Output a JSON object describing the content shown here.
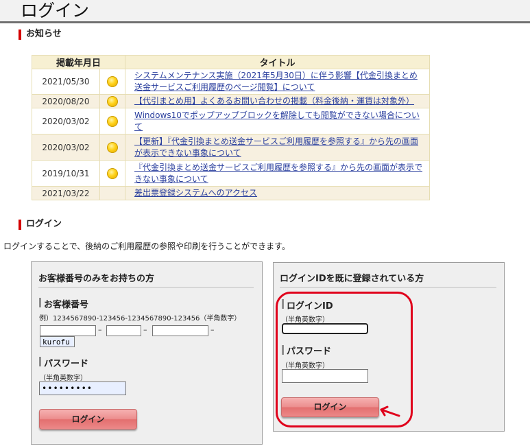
{
  "page": {
    "title": "ログイン"
  },
  "news": {
    "heading": "お知らせ",
    "headers": {
      "date": "掲載年月日",
      "title": "タイトル"
    },
    "rows": [
      {
        "date": "2021/05/30",
        "icon": "new-dot-icon",
        "title": "システムメンテナンス実施（2021年5月30日）に伴う影響【代金引換まとめ送金サービスご利用履歴のページ閲覧】について"
      },
      {
        "date": "2020/08/20",
        "icon": "new-dot-icon",
        "title": "【代引まとめ用】よくあるお問い合わせの掲載（料金後納・運賃は対象外）"
      },
      {
        "date": "2020/03/02",
        "icon": "new-dot-icon",
        "title": "Windows10でポップアップブロックを解除しても閲覧ができない場合について"
      },
      {
        "date": "2020/03/02",
        "icon": "new-dot-icon",
        "title": "【更新】『代金引換まとめ送金サービスご利用履歴を参照する』から先の画面が表示できない事象について"
      },
      {
        "date": "2019/10/31",
        "icon": "new-dot-icon",
        "title": "『代金引換まとめ送金サービスご利用履歴を参照する』から先の画面が表示できない事象について"
      },
      {
        "date": "2021/03/22",
        "icon": "",
        "title": "差出票登録システムへのアクセス"
      }
    ]
  },
  "login_section": {
    "heading": "ログイン",
    "intro": "ログインすることで、後納のご利用履歴の参照や印刷を行うことができます。"
  },
  "customer_panel": {
    "title": "お客様番号のみをお持ちの方",
    "number_label": "お客様番号",
    "number_hint": "例）1234567890-123456-1234567890-123456（半角数字）",
    "number_values": [
      "",
      "",
      "",
      "kurofu"
    ],
    "password_label": "パスワード",
    "password_hint": "（半角英数字）",
    "password_value": "•••••••••",
    "login_button": "ログイン"
  },
  "id_panel": {
    "title": "ログインIDを既に登録されている方",
    "id_label": "ログインID",
    "id_hint": "（半角英数字）",
    "id_value": "",
    "password_label": "パスワード",
    "password_hint": "（半角英数字）",
    "password_value": "",
    "login_button": "ログイン"
  },
  "colors": {
    "accent_red": "#d40000",
    "callout_red": "#e0001b",
    "link": "#2a3f9e",
    "table_header": "#f7f0d2"
  }
}
